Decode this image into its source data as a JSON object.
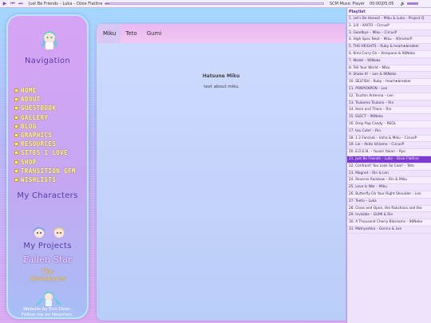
{
  "player": {
    "now_playing": "Just Be Friends – Luka – Dixie Flatline",
    "name": "SCM Music Player",
    "time": "00:00|05:05",
    "progress": 0.02,
    "volume": 0.8
  },
  "sidebar": {
    "nav_title": "Navigation",
    "nav_items": [
      {
        "label": "HOME"
      },
      {
        "label": "ABOUT"
      },
      {
        "label": "GUESTBOOK"
      },
      {
        "label": "GALLERY"
      },
      {
        "label": "BLOG"
      },
      {
        "label": "GRAPHICS"
      },
      {
        "label": "RESOURCES"
      },
      {
        "label": "SITES I LOVE"
      },
      {
        "label": "SHOP"
      },
      {
        "label": "TRANSITION GFM"
      },
      {
        "label": "WISHLISTS"
      }
    ],
    "characters_title": "My Characters",
    "projects_title": "My Projects",
    "project_1": "Fallen Star",
    "project_2_line1": "The",
    "project_2_line2": "Adventures",
    "credit_line1": "Website by Erin Dean.",
    "credit_line2": "Follow me on Neocities."
  },
  "main": {
    "tabs": [
      {
        "label": "Miku"
      },
      {
        "label": "Teto"
      },
      {
        "label": "Gumi"
      }
    ],
    "active_tab": "Miku",
    "content_title": "Hatsune Miku",
    "content_text": "text about miku"
  },
  "playlist": {
    "title": "Playlist",
    "items": [
      "1. Let's Be Honest – Miku & Luka – Project Q",
      "2. 1/4 – KAITO – CircusP",
      "3. Goodbye – Miku – CircusP",
      "4. High Spec Neet – Miku – 40meterP",
      "5. THE HEIGHTS – Ruby & heart★breaker",
      "6. Kimi Carry On – Xeropane & 96Neko",
      "7. Medel – 96Neko",
      "8. Tell Your World – Miku",
      "9. Shake It! – Len & 96Neko",
      "10. SELFISH – Ruby – heart★breaker",
      "11. PONPONPON – Len",
      "12. Tsuzhin Antenna – Len",
      "13. Tsukema Tsukero – Rin",
      "14. Here and There – Rin",
      "15. ELECT – 96Neko",
      "16. Drop Pop Candy – REOL",
      "17. too Cute! – Rin",
      "18. 1 2 Fanclub – Iroha & Miku – CircusP",
      "19. Lie – Akito Ishiame – CircusP",
      "20. E.D.E.N. – Yuzuki Yakari – Ryo",
      "21. Just Be Friends – Luka – Dixie Flatline",
      "22. Confront! You Look So Cool! – Teto",
      "23. Magnet – Rin & Len",
      "24. Reverse Rainbow – Rin & Miku",
      "25. Love Is War – Miku",
      "26. Butterfly On Your Right Shoulder – Len",
      "27. Teeto – Luka",
      "28. Close and Open, the Rakshasa and the",
      "29. Invisible – GUMI & Rin",
      "30. A Thousand Cherry Blossoms – 96Neko",
      "31. Matryoshka – Gorsru & Len"
    ],
    "active_index": 20
  },
  "colors": {
    "accent": "#7c3bd0",
    "nav_text": "#fff4b8",
    "title_text": "#5b3aa8"
  }
}
